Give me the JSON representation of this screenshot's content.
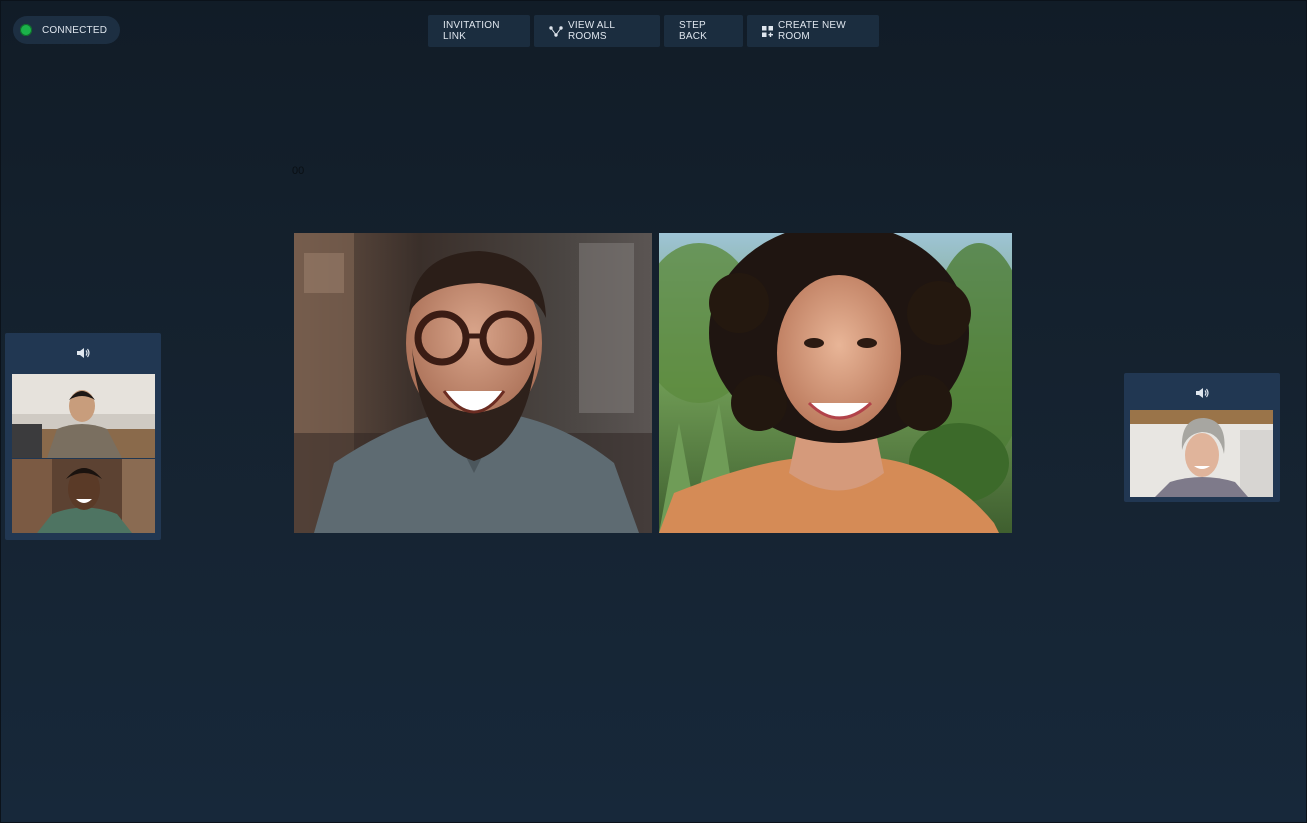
{
  "status": {
    "label": "CONNECTED",
    "color": "#1bb24a"
  },
  "toolbar": {
    "invitation_link": "INVITATION LINK",
    "view_all_rooms": "VIEW ALL ROOMS",
    "step_back": "STEP BACK",
    "create_new_room": "CREATE NEW ROOM"
  },
  "counter": "00",
  "icons": {
    "view_all_rooms": "network-icon",
    "create_new_room": "grid-plus-icon",
    "side_panel": "speaker-icon"
  },
  "colors": {
    "background": "#15222f",
    "button": "#1b2d3f",
    "panel": "#213752"
  }
}
